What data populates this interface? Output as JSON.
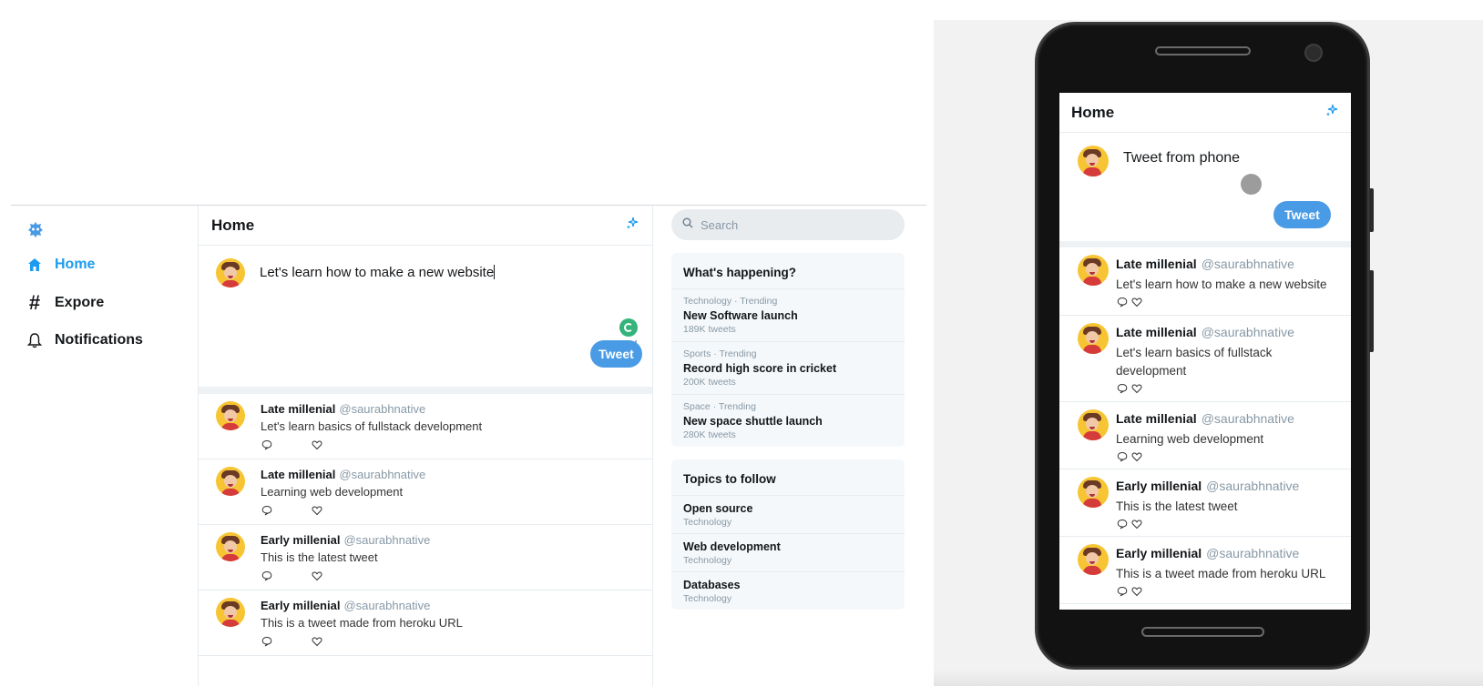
{
  "desktop": {
    "nav": [
      {
        "label": "Home",
        "icon": "home-icon",
        "active": true
      },
      {
        "label": "Expore",
        "icon": "hashtag-icon",
        "active": false
      },
      {
        "label": "Notifications",
        "icon": "bell-icon",
        "active": false
      }
    ],
    "feed": {
      "title": "Home",
      "composer_text": "Let's learn how to make a new website",
      "tweet_button": "Tweet",
      "tweets": [
        {
          "name": "Late millenial",
          "handle": "@saurabhnative",
          "text": "Let's learn basics of fullstack development"
        },
        {
          "name": "Late millenial",
          "handle": "@saurabhnative",
          "text": "Learning web development"
        },
        {
          "name": "Early millenial",
          "handle": "@saurabhnative",
          "text": "This is the latest tweet"
        },
        {
          "name": "Early millenial",
          "handle": "@saurabhnative",
          "text": "This is a tweet made from heroku URL"
        }
      ]
    },
    "search": {
      "placeholder": "Search"
    },
    "happening": {
      "title": "What's happening?",
      "trends": [
        {
          "meta": "Technology · Trending",
          "title": "New Software launch",
          "count": "189K tweets"
        },
        {
          "meta": "Sports · Trending",
          "title": "Record high score in cricket",
          "count": "200K tweets"
        },
        {
          "meta": "Space · Trending",
          "title": "New space shuttle launch",
          "count": "280K tweets"
        }
      ]
    },
    "topics": {
      "title": "Topics to follow",
      "items": [
        {
          "title": "Open source",
          "category": "Technology"
        },
        {
          "title": "Web development",
          "category": "Technology"
        },
        {
          "title": "Databases",
          "category": "Technology"
        }
      ]
    }
  },
  "mobile": {
    "title": "Home",
    "composer_text": "Tweet from phone",
    "tweet_button": "Tweet",
    "tweets": [
      {
        "name": "Late millenial",
        "handle": "@saurabhnative",
        "text": "Let's learn how to make a new website"
      },
      {
        "name": "Late millenial",
        "handle": "@saurabhnative",
        "text": "Let's learn basics of fullstack development"
      },
      {
        "name": "Late millenial",
        "handle": "@saurabhnative",
        "text": "Learning web development"
      },
      {
        "name": "Early millenial",
        "handle": "@saurabhnative",
        "text": "This is the latest tweet"
      },
      {
        "name": "Early millenial",
        "handle": "@saurabhnative",
        "text": "This is a tweet made from heroku URL"
      }
    ]
  },
  "colors": {
    "accent": "#1d9bf0",
    "tweet_button": "#4a9be6",
    "muted": "#8899a6"
  }
}
